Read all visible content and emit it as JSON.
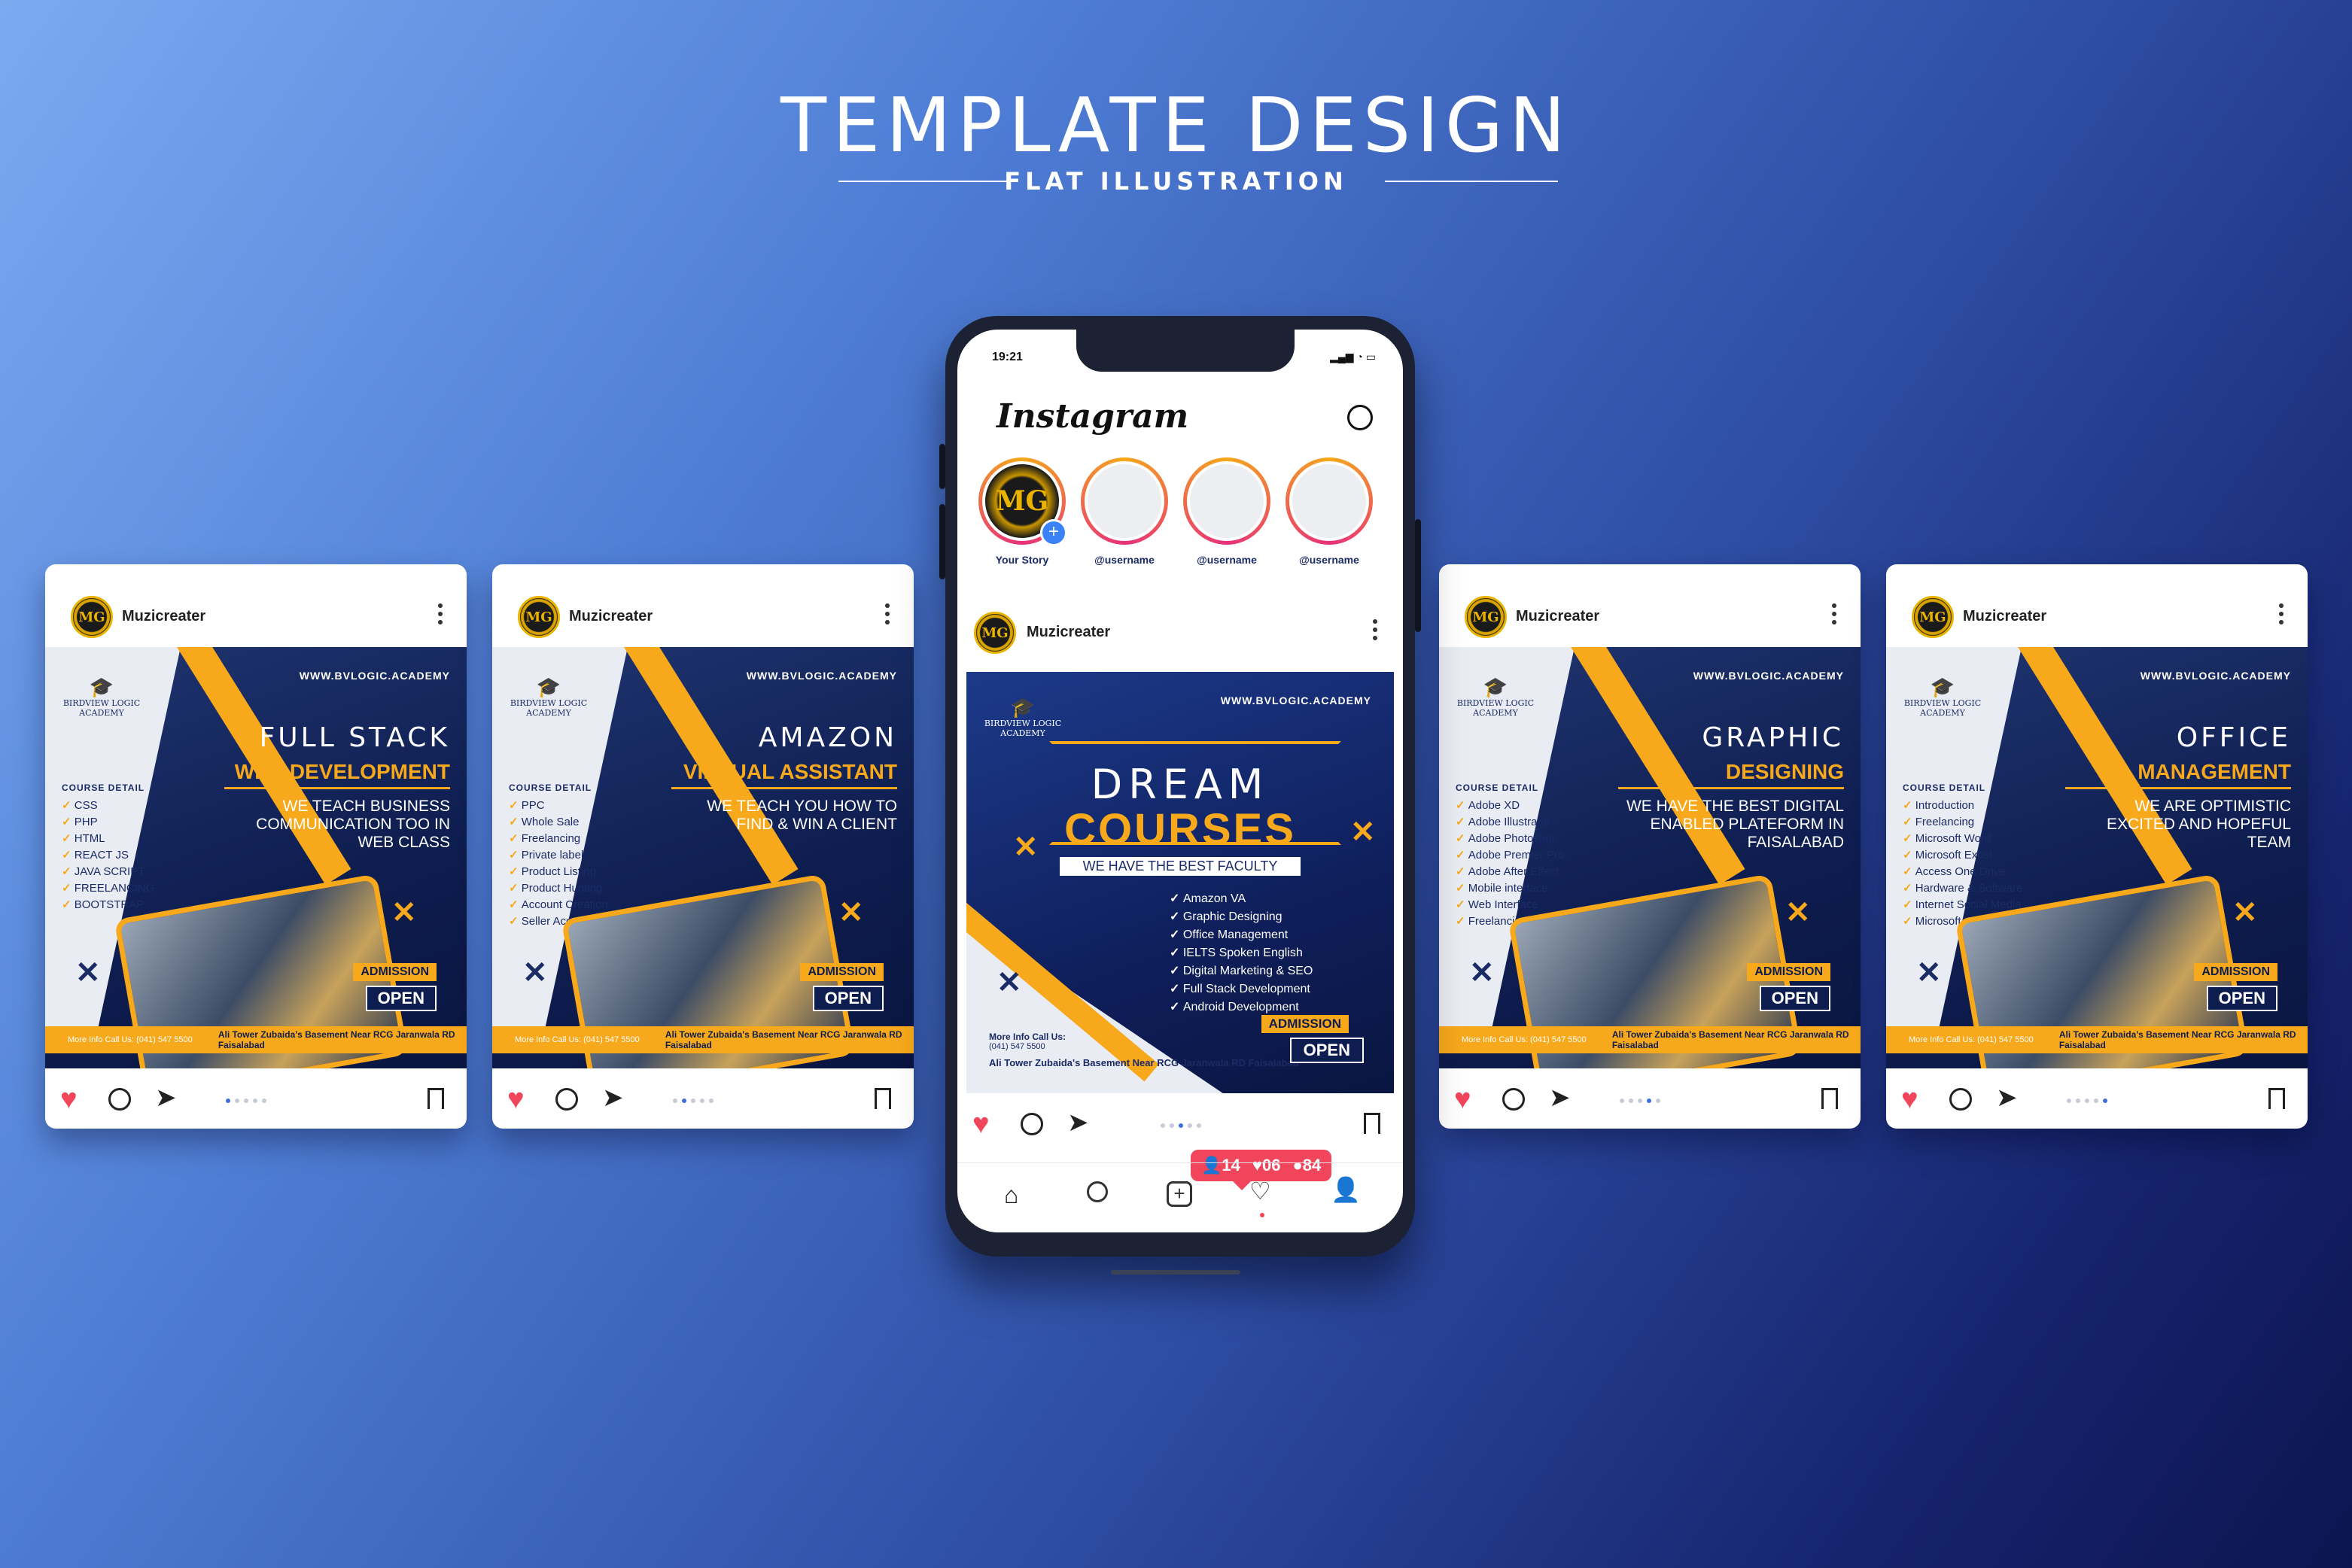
{
  "header": {
    "title": "TEMPLATE DESIGN",
    "subtitle": "FLAT ILLUSTRATION"
  },
  "phone": {
    "time": "19:21",
    "status": "▂▄▆ ◔ ▭",
    "brand": "Instagram",
    "stories": [
      {
        "label": "Your Story",
        "initials": "MG"
      },
      {
        "label": "@username"
      },
      {
        "label": "@username"
      },
      {
        "label": "@username"
      }
    ],
    "notification": {
      "followers": "14",
      "likes": "06",
      "comments": "84"
    }
  },
  "post_common": {
    "username": "Muzicreater",
    "avatar_initials": "MG",
    "url": "WWW.BVLOGIC.ACADEMY",
    "academy": "BIRDVIEW LOGIC ACADEMY",
    "course_detail": "COURSE DETAIL",
    "admission": "ADMISSION",
    "open": "OPEN",
    "call_label": "More Info Call Us:",
    "phone": "(041) 547 5500",
    "address": "Ali Tower Zubaida's Basement Near RCG Jaranwala RD Faisalabad"
  },
  "posts": [
    {
      "title1": "FULL STACK",
      "title2": "WEB DEVELOPMENT",
      "tagline": "WE TEACH BUSINESS COMMUNICATION TOO IN WEB CLASS",
      "items": [
        "CSS",
        "PHP",
        "HTML",
        "REACT JS",
        "JAVA SCRIPT",
        "FREELANCING",
        "BOOTSTRAP"
      ],
      "page": 0
    },
    {
      "title1": "AMAZON",
      "title2": "VIRTUAL ASSISTANT",
      "tagline": "WE TEACH YOU HOW TO FIND & WIN A CLIENT",
      "items": [
        "PPC",
        "Whole Sale",
        "Freelancing",
        "Private label",
        "Product Listing",
        "Product Hunting",
        "Account Creation",
        "Seller Account Management"
      ],
      "page": 1
    },
    {
      "title1": "GRAPHIC",
      "title2": "DESIGNING",
      "tagline": "WE HAVE THE BEST DIGITAL ENABLED PLATEFORM IN FAISALABAD",
      "items": [
        "Adobe XD",
        "Adobe Illustrator",
        "Adobe Photoshop",
        "Adobe Premier Pro",
        "Adobe After Effect",
        "Mobile interface",
        "Web Interface",
        "Freelancing"
      ],
      "page": 3
    },
    {
      "title1": "OFFICE",
      "title2": "MANAGEMENT",
      "tagline": "WE ARE OPTIMISTIC EXCITED AND HOPEFUL TEAM",
      "items": [
        "Introduction",
        "Freelancing",
        "Microsoft Word",
        "Microsoft Excel",
        "Access One Drive",
        "Hardware & Software",
        "Internet Social Media",
        "Microsoft Power Point"
      ],
      "page": 4
    }
  ],
  "center_post": {
    "title1": "DREAM",
    "title2": "COURSES",
    "faculty": "WE HAVE THE BEST FACULTY",
    "items": [
      "Amazon VA",
      "Graphic Designing",
      "Office Management",
      "IELTS Spoken English",
      "Digital Marketing & SEO",
      "Full Stack Development",
      "Android Development"
    ],
    "address": "Ali Tower Zubaida's Basement Near RCG Jaranwala RD Faisalabad"
  },
  "colors": {
    "accent": "#f7a81b",
    "navy": "#0e1d4f",
    "like": "#f0455a",
    "pager_active": "#3d6fd8"
  },
  "icons": [
    "heart-icon",
    "comment-icon",
    "send-icon",
    "bookmark-icon",
    "messenger-icon",
    "home-icon",
    "search-icon",
    "add-icon",
    "user-icon"
  ]
}
